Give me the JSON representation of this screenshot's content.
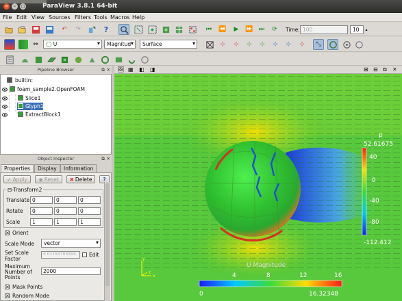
{
  "window": {
    "title": "ParaView 3.8.1 64-bit"
  },
  "menu": [
    "File",
    "Edit",
    "View",
    "Sources",
    "Filters",
    "Tools",
    "Macros",
    "Help"
  ],
  "time": {
    "label": "Time:",
    "value": "100",
    "step": "10"
  },
  "toolbar2": {
    "scalar_select": "U",
    "component_select": "Magnitud",
    "representation_select": "Surface"
  },
  "pipeline": {
    "title": "Pipeline Browser",
    "items": [
      {
        "label": "builtin:",
        "color": "#555555"
      },
      {
        "label": "foam_sample2.OpenFOAM",
        "color": "#3c9a3c"
      },
      {
        "label": "Slice1",
        "color": "#3c9a3c"
      },
      {
        "label": "Glyph1",
        "color": "#3c9a3c",
        "selected": true
      },
      {
        "label": "ExtractBlock1",
        "color": "#3c9a3c"
      }
    ]
  },
  "inspector": {
    "title": "Object Inspector",
    "tabs": [
      "Properties",
      "Display",
      "Information"
    ],
    "buttons": {
      "apply": "Apply",
      "reset": "Reset",
      "delete": "Delete",
      "help": "?"
    },
    "group": "Transform2",
    "translate": {
      "label": "Translate",
      "values": [
        "0",
        "0",
        "0"
      ]
    },
    "rotate": {
      "label": "Rotate",
      "values": [
        "0",
        "0",
        "0"
      ]
    },
    "scale": {
      "label": "Scale",
      "values": [
        "1",
        "1",
        "1"
      ]
    },
    "orient": {
      "label": "Orient",
      "checked": true
    },
    "scale_mode": {
      "label": "Scale Mode",
      "value": "vector"
    },
    "scale_factor": {
      "label1": "Set Scale",
      "label2": "Factor",
      "value": "0.01153703304",
      "edit": "Edit"
    },
    "max_points": {
      "label1": "Maximum",
      "label2": "Number of",
      "label3": "Points",
      "value": "2000"
    },
    "mask_points": {
      "label": "Mask Points",
      "checked": true
    },
    "random_mode": {
      "label": "Random Mode",
      "checked": true
    }
  },
  "render": {
    "vertical_bar": {
      "title": "p",
      "max": "52.61675",
      "ticks": [
        "40",
        "0",
        "-40",
        "-80"
      ],
      "min": "-112.412"
    },
    "horizontal_bar": {
      "title": "U Magnitude",
      "ticks": [
        "4",
        "8",
        "12",
        "16"
      ],
      "min": "0",
      "max": "16.32348"
    },
    "axes": {
      "x": "x",
      "y": "y",
      "z": "z"
    }
  },
  "colors": {
    "toolbar": "#dcd9d4",
    "panel": "#d6d3ce",
    "selected": "#3b6fb6",
    "titlebar": "#2f2f2d"
  }
}
